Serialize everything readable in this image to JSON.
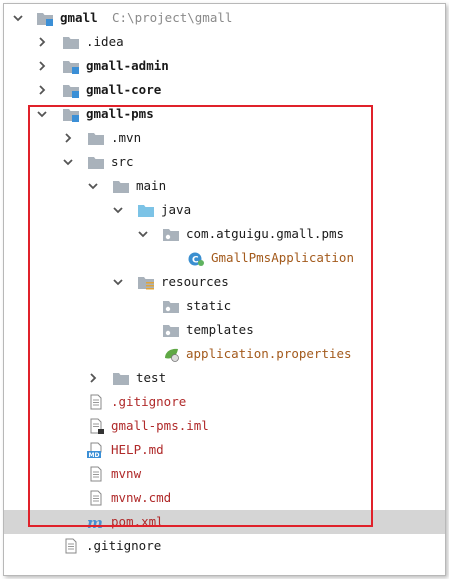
{
  "tree": {
    "root": {
      "label": "gmall",
      "path": "C:\\project\\gmall"
    },
    "items": [
      {
        "label": ".idea"
      },
      {
        "label": "gmall-admin"
      },
      {
        "label": "gmall-core"
      },
      {
        "label": "gmall-pms"
      },
      {
        "label": ".mvn"
      },
      {
        "label": "src"
      },
      {
        "label": "main"
      },
      {
        "label": "java"
      },
      {
        "label": "com.atguigu.gmall.pms"
      },
      {
        "label": "GmallPmsApplication"
      },
      {
        "label": "resources"
      },
      {
        "label": "static"
      },
      {
        "label": "templates"
      },
      {
        "label": "application.properties"
      },
      {
        "label": "test"
      },
      {
        "label": ".gitignore"
      },
      {
        "label": "gmall-pms.iml"
      },
      {
        "label": "HELP.md"
      },
      {
        "label": "mvnw"
      },
      {
        "label": "mvnw.cmd"
      },
      {
        "label": "pom.xml"
      },
      {
        "label": ".gitignore"
      }
    ]
  },
  "colors": {
    "selection": "#d5d5d5",
    "highlight_border": "#e0212a",
    "folder": "#a9b2bb",
    "source_folder": "#7cc3e6",
    "module_marker": "#3b8fd6"
  }
}
